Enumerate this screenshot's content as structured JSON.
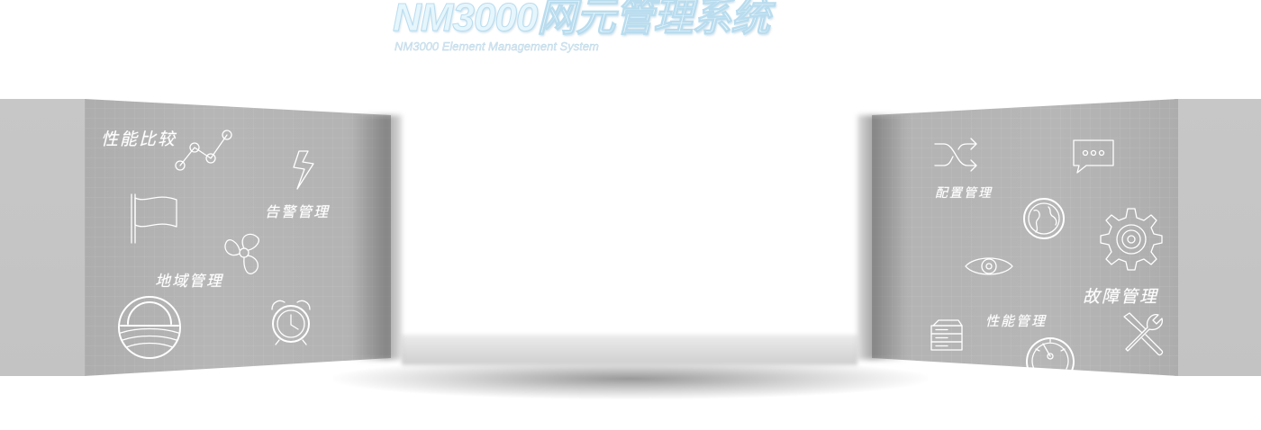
{
  "header": {
    "title": "NM3000网元管理系统",
    "subtitle": "NM3000 Element Management System"
  },
  "left_panel": {
    "labels": {
      "performance_compare": "性能比较",
      "alarm_management": "告警管理",
      "region_management": "地域管理"
    },
    "icons": [
      "line-chart-icon",
      "lightning-icon",
      "flag-icon",
      "fan-icon",
      "sunrise-icon",
      "alarm-clock-icon"
    ]
  },
  "right_panel": {
    "labels": {
      "config_management": "配置管理",
      "fault_management": "故障管理",
      "performance_management": "性能管理"
    },
    "icons": [
      "shuffle-icon",
      "chat-bubble-icon",
      "globe-icon",
      "gear-icon",
      "eye-icon",
      "server-icon",
      "speedometer-icon",
      "tools-icon"
    ]
  },
  "colors": {
    "panel_gray": "#b3b3b3",
    "title_tint": "#e6f6fd",
    "icon_stroke": "#ffffff"
  }
}
